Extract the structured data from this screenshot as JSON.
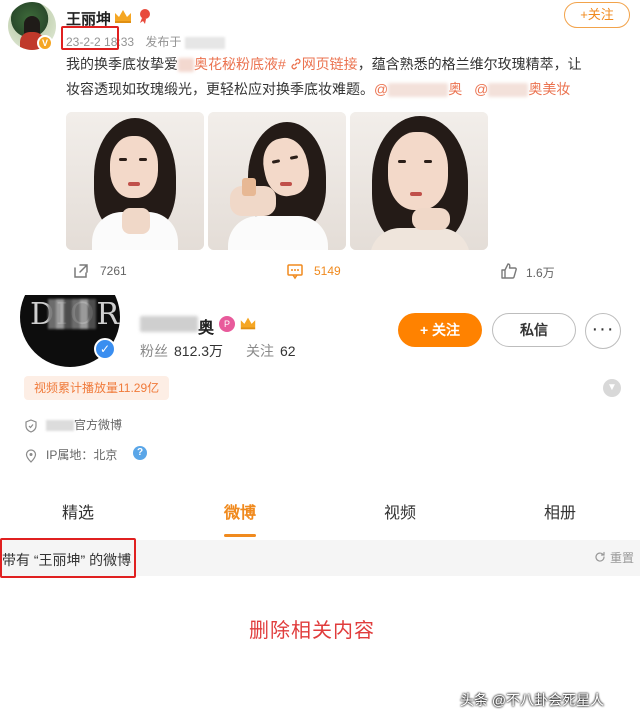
{
  "post": {
    "author": "王丽坤",
    "date": "23-2-2",
    "time": "18:33",
    "published_label": "发布于",
    "follow_label": "+关注",
    "text_line1_a": "我的换季底妆挚爱",
    "hashtag": "奥花秘粉底液#",
    "web_link": "网页链接",
    "text_line1_b": "，蕴含熟悉的格兰维尔玫瑰精萃，让",
    "text_line2_a": "妆容透现如玫瑰缎光，更轻松应对换季底妆难题。",
    "mention_1": "@",
    "mention_1_tail": "奥",
    "mention_2": "@",
    "mention_2_tail": "奥美妆",
    "reposts": "7261",
    "comments": "5149",
    "likes": "1.6万"
  },
  "profile": {
    "avatar_logo": "DIOR",
    "name_tail": "奥",
    "follow_label": "+ 关注",
    "dm_label": "私信",
    "more_label": "···",
    "fans_label": "粉丝",
    "fans_value": "812.3万",
    "following_label": "关注",
    "following_value": "62",
    "views_badge": "视频累计播放量11.29亿",
    "official_suffix": "官方微博",
    "ip_label": "IP属地：北京"
  },
  "tabs": [
    "精选",
    "微博",
    "视频",
    "相册"
  ],
  "active_tab": "微博",
  "filter": {
    "text": "带有 “王丽坤” 的微博",
    "reset_label": "重置"
  },
  "body": {
    "deleted_notice": "删除相关内容"
  },
  "watermark": "头条 @不八卦会死星人",
  "colors": {
    "accent_orange": "#ff8200",
    "link_orange": "#eb7350",
    "annotation_red": "#e02020",
    "deleted_red": "#e03c3c",
    "verified_blue": "#3a8ef0"
  },
  "icons": [
    "crown-icon",
    "ribbon-icon",
    "repost-icon",
    "comment-icon",
    "like-icon",
    "chain-link-icon",
    "verified-icon",
    "shield-icon",
    "location-icon",
    "help-icon",
    "chevron-down-icon",
    "refresh-icon"
  ]
}
